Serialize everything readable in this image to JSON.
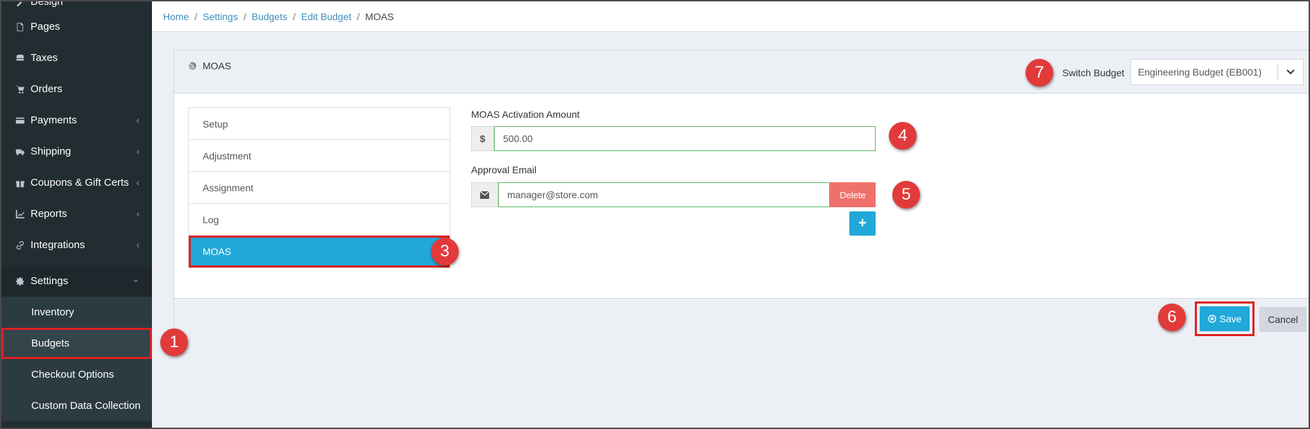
{
  "sidebar": {
    "items": [
      {
        "label": "Design",
        "icon": "brush-icon"
      },
      {
        "label": "Pages",
        "icon": "file-icon"
      },
      {
        "label": "Taxes",
        "icon": "coins-icon"
      },
      {
        "label": "Orders",
        "icon": "cart-icon"
      },
      {
        "label": "Payments",
        "icon": "credit-card-icon",
        "chevron": "‹"
      },
      {
        "label": "Shipping",
        "icon": "truck-icon",
        "chevron": "‹"
      },
      {
        "label": "Coupons & Gift Certs",
        "icon": "gift-icon",
        "chevron": "‹"
      },
      {
        "label": "Reports",
        "icon": "chart-icon",
        "chevron": "‹"
      },
      {
        "label": "Integrations",
        "icon": "link-icon",
        "chevron": "‹"
      },
      {
        "label": "Settings",
        "icon": "gear-icon",
        "chevron": "⌄"
      }
    ],
    "subitems": [
      {
        "label": "Inventory"
      },
      {
        "label": "Budgets"
      },
      {
        "label": "Checkout Options"
      },
      {
        "label": "Custom Data Collection"
      }
    ]
  },
  "breadcrumb": {
    "home": "Home",
    "settings": "Settings",
    "budgets": "Budgets",
    "edit_budget": "Edit Budget",
    "current": "MOAS",
    "separator": "/"
  },
  "panel": {
    "title": "MOAS",
    "switch_budget_label": "Switch Budget",
    "switch_budget_value": "Engineering Budget (EB001)"
  },
  "tabs": [
    "Setup",
    "Adjustment",
    "Assignment",
    "Log",
    "MOAS"
  ],
  "form": {
    "activation_label": "MOAS Activation Amount",
    "currency_symbol": "$",
    "activation_value": "500.00",
    "approval_label": "Approval Email",
    "approval_value": "manager@store.com",
    "delete_label": "Delete",
    "add_label": "+"
  },
  "footer": {
    "save_label": "Save",
    "cancel_label": "Cancel"
  },
  "badges": [
    "1",
    "3",
    "4",
    "5",
    "6",
    "7"
  ],
  "colors": {
    "sidebar_bg": "#222d32",
    "accent": "#21a8d8",
    "danger": "#f0716b",
    "highlight": "#e02020",
    "badge": "#e23a3a",
    "input_border": "#5cb85c"
  }
}
